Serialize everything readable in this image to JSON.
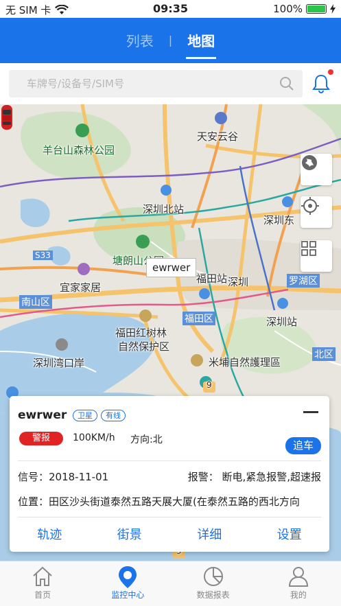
{
  "status_bar": {
    "carrier": "无 SIM 卡",
    "time": "09:35",
    "battery": "100%"
  },
  "header": {
    "tabs": [
      {
        "label": "列表",
        "active": false
      },
      {
        "label": "地图",
        "active": true
      }
    ],
    "separator": "|"
  },
  "search": {
    "placeholder": "车牌号/设备号/SIM号"
  },
  "map": {
    "labels": [
      "天安云谷",
      "羊台山森林公园",
      "深圳北站",
      "深圳东",
      "塘朗山公园",
      "宜家家居",
      "福田站",
      "深圳",
      "罗湖区",
      "南山区",
      "福田区",
      "福田红树林",
      "自然保护区",
      "深圳站",
      "深圳湾口岸",
      "米埔自然護理區",
      "北区",
      "S33"
    ],
    "car_callout": "ewrwer",
    "road_markers": [
      "9",
      "9"
    ]
  },
  "vehicle_card": {
    "name": "ewrwer",
    "badges": [
      "卫星",
      "有线"
    ],
    "alarm_label": "警报",
    "speed": "100KM/h",
    "direction": "方向:北",
    "chase_button": "追车",
    "signal": "信号：2018-11-01",
    "report": "报警：  断电,紧急报警,超速报",
    "location": "位置：田区沙头街道泰然五路天展大厦(在泰然五路的西北方向",
    "actions": [
      "轨迹",
      "街景",
      "详细",
      "设置"
    ]
  },
  "bottom_nav": [
    {
      "label": "首页",
      "icon": "home-icon",
      "active": false
    },
    {
      "label": "监控中心",
      "icon": "location-pin-icon",
      "active": true
    },
    {
      "label": "数据报表",
      "icon": "pie-chart-icon",
      "active": false
    },
    {
      "label": "我的",
      "icon": "user-icon",
      "active": false
    }
  ],
  "colors": {
    "primary": "#1a73e8",
    "alarm": "#e02424",
    "battery": "#2bc54a",
    "notify_dot": "#f23030"
  }
}
